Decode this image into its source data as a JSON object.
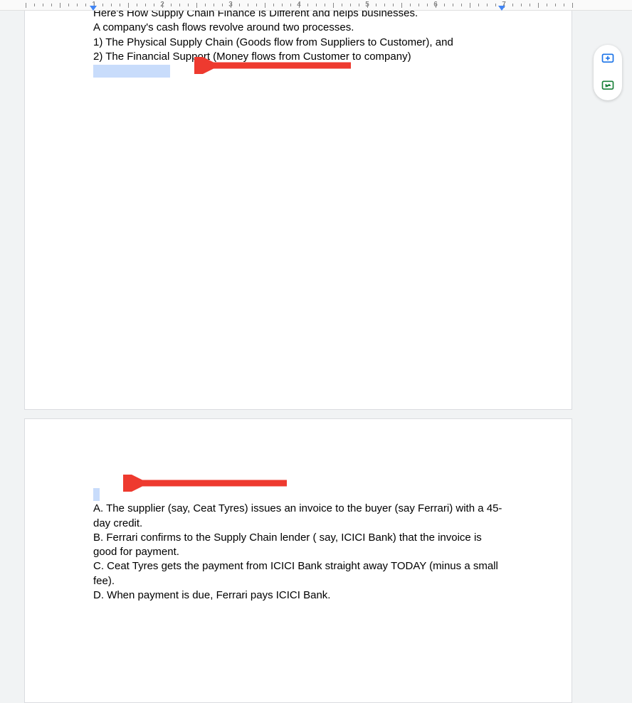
{
  "ruler": {
    "numbers": [
      1,
      2,
      3,
      4,
      5,
      6,
      7
    ]
  },
  "page1": {
    "line1": "Here's How Supply Chain Finance is Different and helps businesses.",
    "line2": "A company's cash flows revolve around two processes.",
    "line3": "1) The Physical Supply Chain (Goods flow from Suppliers to Customer), and",
    "line4": "2) The Financial Support (Money flows from Customer to company)"
  },
  "page2": {
    "lineA": "A. The supplier (say, Ceat Tyres) issues an invoice to the buyer (say Ferrari) with a 45-day credit.",
    "lineB": "B. Ferrari confirms to the Supply Chain lender ( say, ICICI Bank) that the invoice is good for payment.",
    "lineC": "C. Ceat Tyres gets the payment from ICICI Bank straight away TODAY (minus a small fee).",
    "lineD": "D. When payment is due, Ferrari pays ICICI Bank."
  },
  "side": {
    "comment": "Add comment",
    "suggest": "Suggest edits"
  }
}
